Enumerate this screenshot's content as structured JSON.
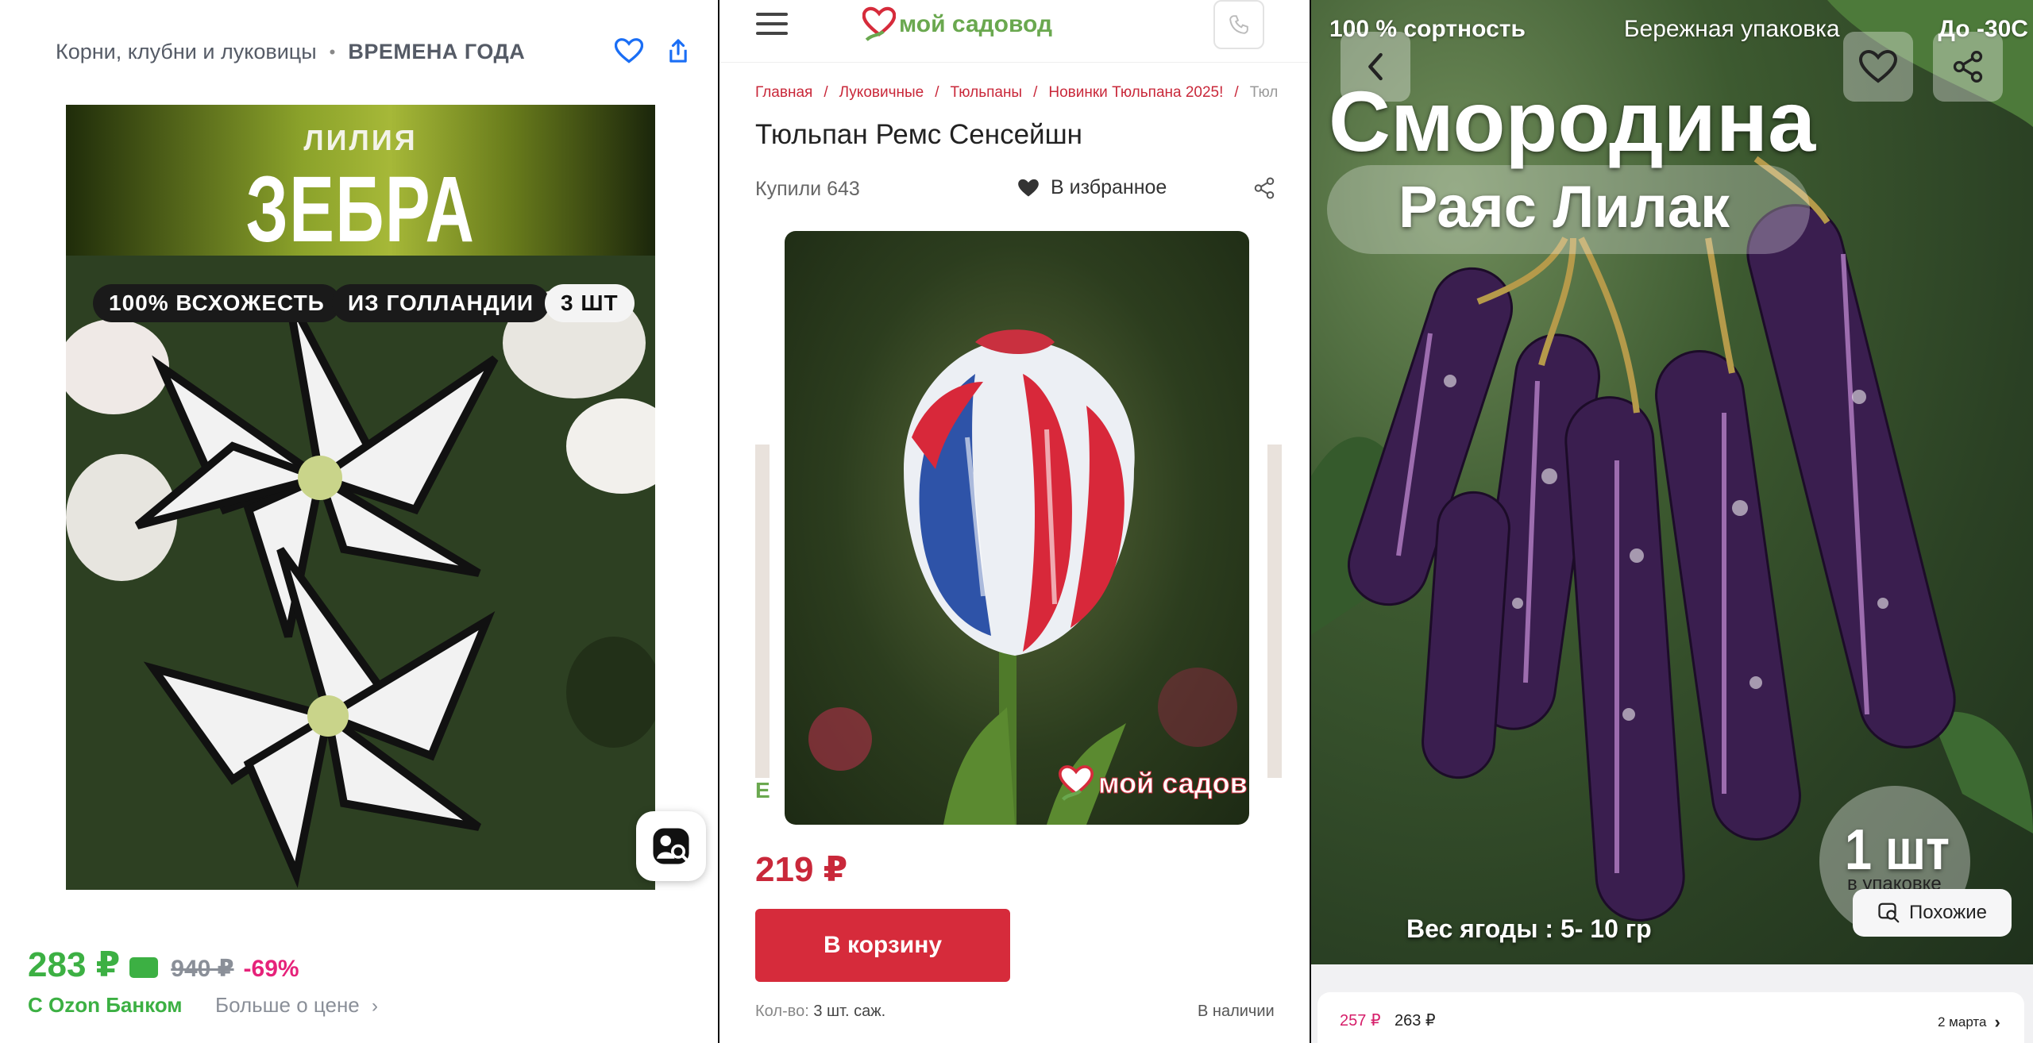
{
  "ozon": {
    "breadcrumb_category": "Корни, клубни и луковицы",
    "breadcrumb_sep": "•",
    "breadcrumb_brand": "ВРЕМЕНА ГОДА",
    "image": {
      "subtitle": "ЛИЛИЯ",
      "title": "ЗЕБРА",
      "badges": [
        "100% ВСХОЖЕСТЬ",
        "ИЗ ГОЛЛАНДИИ",
        "3 ШТ"
      ]
    },
    "price": "283 ₽",
    "old_price": "940 ₽",
    "discount": "-69%",
    "bank_label": "С Ozon Банком",
    "more_price_label": "Больше о цене",
    "colors": {
      "price_green": "#3cb043",
      "discount_pink": "#e6227a"
    },
    "icons": [
      "heart-icon",
      "share-icon",
      "visual-search-icon",
      "chevron-right-icon"
    ]
  },
  "sadovod": {
    "logo_text": "мой садовод",
    "breadcrumbs": [
      "Главная",
      "Луковичные",
      "Тюльпаны",
      "Новинки Тюльпана 2025!",
      "Тюл"
    ],
    "breadcrumb_sep": "/",
    "title": "Тюльпан Ремс Сенсейшн",
    "bought": "Купили 643",
    "favorite_label": "В избранное",
    "watermark": "мой садов",
    "left_peek": "Е",
    "price": "219 ₽",
    "cart_button": "В корзину",
    "qty_label": "Кол-во:",
    "qty_value": "3 шт. саж.",
    "stock": "В наличии",
    "colors": {
      "accent_red": "#d62b3b"
    },
    "icons": [
      "menu-icon",
      "phone-icon",
      "heart-icon",
      "share-icon"
    ]
  },
  "wb": {
    "top_line": [
      "100 % сортность",
      "Бережная упаковка",
      "До -30С"
    ],
    "title": "Смородина",
    "subtitle": "Раяс Лилак",
    "qty": "1 шт",
    "qty_sub": "в упаковке",
    "similar_label": "Похожие",
    "berry_weight": "Вес ягоды : 5- 10 гр",
    "price_card": "257 ₽",
    "price": "263 ₽",
    "delivery_date": "2 марта",
    "colors": {
      "price_pink": "#d61e6a"
    },
    "icons": [
      "back-icon",
      "heart-icon",
      "share-icon",
      "similar-icon",
      "chevron-right-icon"
    ]
  }
}
